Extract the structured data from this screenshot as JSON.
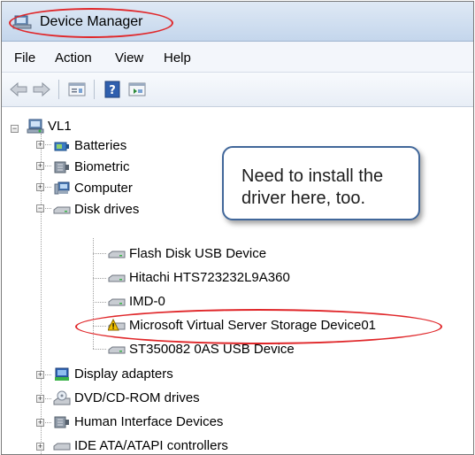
{
  "window": {
    "title": "Device Manager"
  },
  "menu": [
    "File",
    "Action",
    "View",
    "Help"
  ],
  "toolbar": {
    "buttons": [
      "back-arrow-icon",
      "forward-arrow-icon",
      "properties-icon",
      "help-icon",
      "show-hidden-icon"
    ]
  },
  "tree": {
    "root": "VL1",
    "categories": [
      {
        "label": "Batteries",
        "icon": "battery-icon"
      },
      {
        "label": "Biometric",
        "icon": "biometric-icon"
      },
      {
        "label": "Computer",
        "icon": "computer-icon"
      },
      {
        "label": "Disk drives",
        "icon": "disk-drive-icon",
        "expanded": true
      },
      {
        "label": "Display adapters",
        "icon": "display-adapter-icon"
      },
      {
        "label": "DVD/CD-ROM drives",
        "icon": "dvd-drive-icon"
      },
      {
        "label": "Human Interface Devices",
        "icon": "hid-icon"
      },
      {
        "label": "IDE ATA/ATAPI controllers",
        "icon": "ide-controller-icon"
      }
    ],
    "disk_drives": [
      {
        "label": "Flash Disk USB Device",
        "warning": false
      },
      {
        "label": "Hitachi HTS723232L9A360",
        "warning": false
      },
      {
        "label": "IMD-0",
        "warning": false
      },
      {
        "label": "Microsoft Virtual Server Storage Device01",
        "warning": true
      },
      {
        "label": "ST350082 0AS USB Device",
        "warning": false
      }
    ]
  },
  "callout": {
    "text": "Need to install the driver here, too."
  },
  "colors": {
    "highlight": "#e0272a",
    "callout_border": "#41679a"
  }
}
